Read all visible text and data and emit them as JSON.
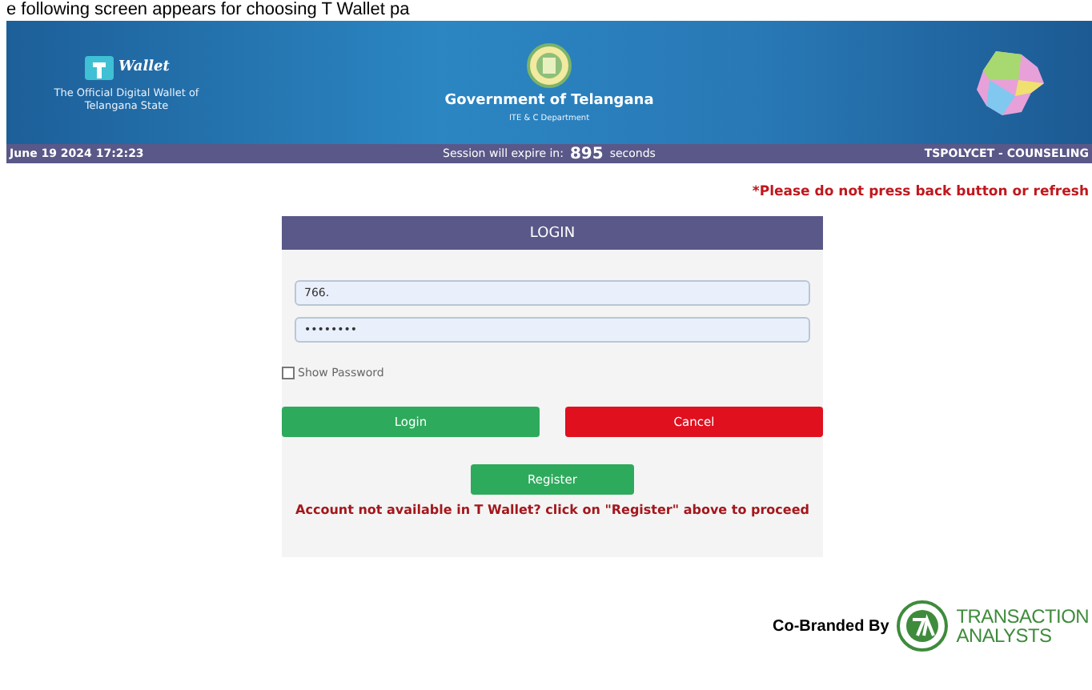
{
  "caption": "e following screen appears for choosing T Wallet pa",
  "header": {
    "logo_text": "Wallet",
    "tagline": "The Official Digital Wallet of Telangana State",
    "title": "Government of Telangana",
    "subtitle": "ITE & C Department"
  },
  "status_bar": {
    "datetime": "June 19 2024 17:2:23",
    "session_label": "Session will expire in:",
    "seconds": "895",
    "seconds_unit": "seconds",
    "portal": "TSPOLYCET - COUNSELING"
  },
  "warning": "*Please do not press back button or refresh",
  "login": {
    "title": "LOGIN",
    "username": "766.",
    "password": "••••••••",
    "show_password": {
      "label": "Show Password",
      "checked": false
    },
    "buttons": [
      {
        "label": "Login",
        "kind": "ok"
      },
      {
        "label": "Cancel",
        "kind": "cancel"
      }
    ],
    "register": "Register",
    "message": "Account not available in T Wallet? click on \"Register\" above to proceed"
  },
  "footer": {
    "label": "Co-Branded By",
    "brand_line1": "TRANSACTION",
    "brand_line2": "ANALYSTS"
  }
}
